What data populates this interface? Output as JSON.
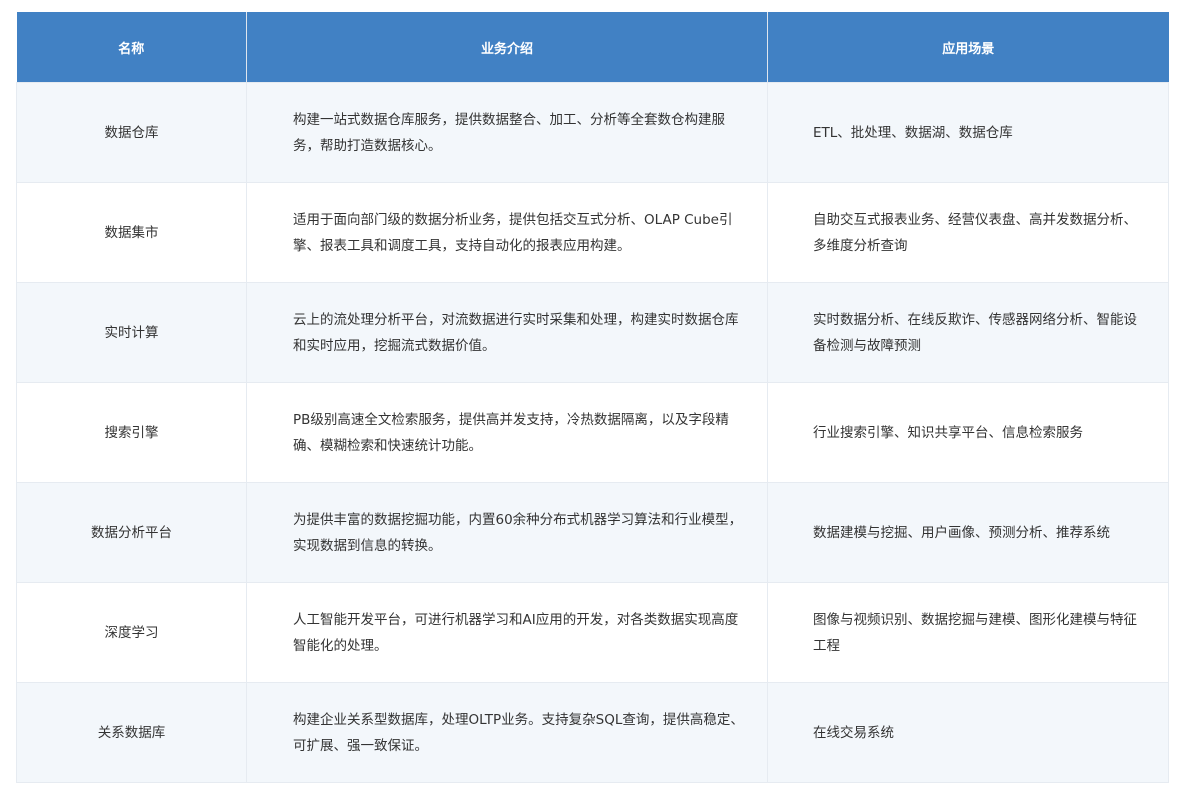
{
  "table": {
    "headers": [
      "名称",
      "业务介绍",
      "应用场景"
    ],
    "rows": [
      {
        "name": "数据仓库",
        "description": "构建一站式数据仓库服务，提供数据整合、加工、分析等全套数仓构建服务，帮助打造数据核心。",
        "scenarios": "ETL、批处理、数据湖、数据仓库"
      },
      {
        "name": "数据集市",
        "description": "适用于面向部门级的数据分析业务，提供包括交互式分析、OLAP Cube引擎、报表工具和调度工具，支持自动化的报表应用构建。",
        "scenarios": "自助交互式报表业务、经营仪表盘、高并发数据分析、多维度分析查询"
      },
      {
        "name": "实时计算",
        "description": "云上的流处理分析平台，对流数据进行实时采集和处理，构建实时数据仓库和实时应用，挖掘流式数据价值。",
        "scenarios": "实时数据分析、在线反欺诈、传感器网络分析、智能设备检测与故障预测"
      },
      {
        "name": "搜索引擎",
        "description": "PB级别高速全文检索服务，提供高并发支持，冷热数据隔离，以及字段精确、模糊检索和快速统计功能。",
        "scenarios": "行业搜索引擎、知识共享平台、信息检索服务"
      },
      {
        "name": "数据分析平台",
        "description": "为提供丰富的数据挖掘功能，内置60余种分布式机器学习算法和行业模型，实现数据到信息的转换。",
        "scenarios": "数据建模与挖掘、用户画像、预测分析、推荐系统"
      },
      {
        "name": "深度学习",
        "description": "人工智能开发平台，可进行机器学习和AI应用的开发，对各类数据实现高度智能化的处理。",
        "scenarios": "图像与视频识别、数据挖掘与建模、图形化建模与特征工程"
      },
      {
        "name": "关系数据库",
        "description": "构建企业关系型数据库，处理OLTP业务。支持复杂SQL查询，提供高稳定、可扩展、强一致保证。",
        "scenarios": "在线交易系统"
      }
    ]
  },
  "colors": {
    "header_bg": "#4181c4",
    "header_text": "#ffffff",
    "row_stripe": "#f3f7fb",
    "border": "#e6ebf1",
    "body_text": "#333333"
  }
}
